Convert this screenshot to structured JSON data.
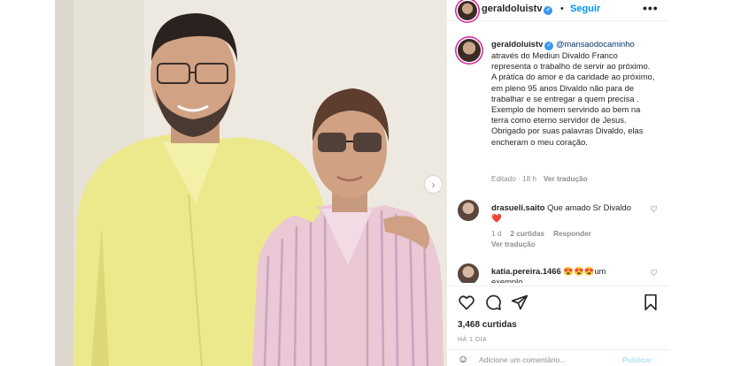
{
  "post": {
    "username": "geraldoluistv",
    "follow_label": "Seguir",
    "separator": "•",
    "more_label": "•••",
    "carousel_next": "›"
  },
  "caption": {
    "username": "geraldoluistv",
    "mention": "@mansaodocaminho",
    "text": "através do Mediun Divaldo Franco representa o trabalho de servir ao próximo. A prática do amor e da caridade ao próximo, em pleno 95 anos Divaldo não para de trabalhar e se entregar a quem precisa . Exemplo de homem servindo ao bem na terra como eterno servidor de Jesus. Obrigado por suas palavras Divaldo, elas encheram o meu coração.",
    "time": "Editado · 18 h",
    "translate": "Ver tradução"
  },
  "comments": [
    {
      "username": "drasueli.saito",
      "text": "Que amado Sr Divaldo❤️",
      "time": "1 d",
      "likes": "2 curtidas",
      "reply": "Responder",
      "translate": "Ver tradução"
    },
    {
      "username": "katia.pereira.1466",
      "text": "😍😍😍um exemplo"
    }
  ],
  "stats": {
    "likes": "3,468 curtidas",
    "ago": "HÁ 1 DIA"
  },
  "add_comment": {
    "placeholder": "Adicione um comentário...",
    "post_label": "Publicar"
  },
  "colors": {
    "link_blue": "#0095f6",
    "mention_blue": "#00376b",
    "muted": "#8e8e8e"
  }
}
